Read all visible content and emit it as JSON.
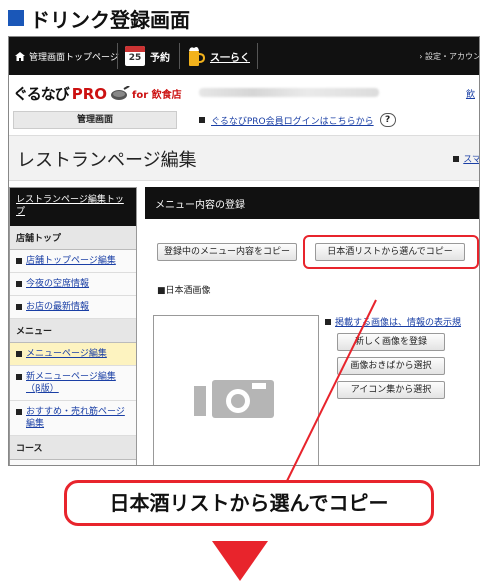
{
  "heading": "ドリンク登録画面",
  "topbar": {
    "home_label": "管理画面トップページ",
    "calendar_num": "25",
    "reservation_label": "予約",
    "beer_label": "ス一らく",
    "settings_label": "› 設定・アカウン"
  },
  "brand": {
    "logo_gurunavi": "ぐるなび",
    "logo_pro": "PRO",
    "logo_for": "for 飲食店",
    "right_link": "飲"
  },
  "kanri_label": "管理画面",
  "login_link": "ぐるなびPRO会員ログインはこちらから",
  "help_glyph": "?",
  "page_title": "レストランページ編集",
  "page_title_right": "スマ",
  "sidebar": {
    "header": "レストランページ編集トップ",
    "sections": [
      {
        "title": "店舗トップ",
        "items": [
          {
            "label": "店舗トップページ編集"
          },
          {
            "label": "今夜の空席情報"
          },
          {
            "label": "お店の最新情報"
          }
        ]
      },
      {
        "title": "メニュー",
        "items": [
          {
            "label": "メニューページ編集",
            "active": true
          },
          {
            "label": "新メニューページ編集（β版）"
          },
          {
            "label": "おすすめ・売れ筋ページ編集"
          }
        ]
      },
      {
        "title": "コース",
        "items": []
      }
    ]
  },
  "content": {
    "header": "メニュー内容の登録",
    "copy_current_button": "登録中のメニュー内容をコピー",
    "sake_list_button": "日本酒リストから選んでコピー",
    "image_label": "■日本酒画像",
    "image_note": "掲載する画像は、情報の表示規",
    "register_image_button": "新しく画像を登録",
    "choose_storage_button": "画像おきばから選択",
    "choose_icon_button": "アイコン集から選択"
  },
  "callout": "日本酒リストから選んでコピー",
  "colors": {
    "accent_red": "#e8242c",
    "heading_blue": "#1a57b8",
    "link_blue": "#1a3fa5"
  }
}
